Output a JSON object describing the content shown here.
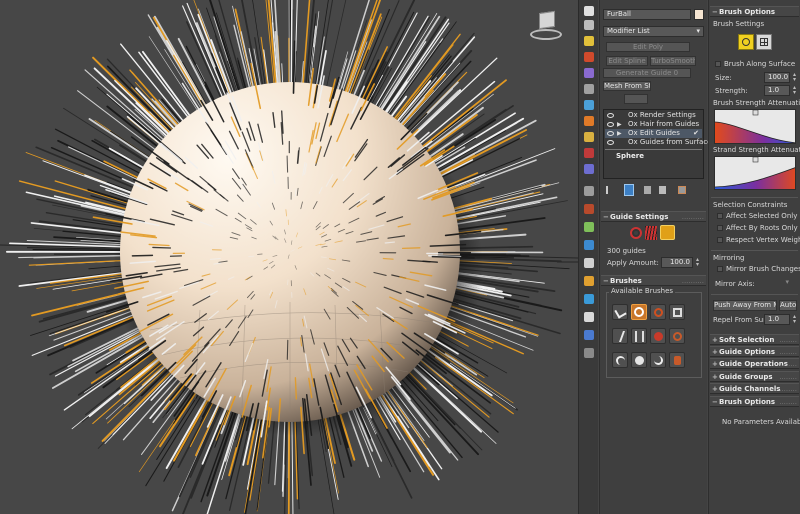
{
  "object_name": "FurBall",
  "modifier_list_label": "Modifier List",
  "modifier_buttons": [
    "Edit Poly",
    "Edit Spline",
    "TurboSmooth",
    "Generate Guide 0",
    "Mesh From Strand"
  ],
  "stack": [
    {
      "label": "Ox Render Settings",
      "expand": false,
      "checked": false
    },
    {
      "label": "Ox Hair from Guides",
      "expand": true,
      "checked": false
    },
    {
      "label": "Ox Edit Guides",
      "expand": true,
      "checked": true
    },
    {
      "label": "Ox Guides from Surface",
      "expand": false,
      "checked": false
    }
  ],
  "stack_base": "Sphere",
  "guide_settings": {
    "title": "Guide Settings",
    "count_text": "300 guides",
    "apply_amount_label": "Apply Amount:",
    "apply_amount_value": "100.0"
  },
  "brushes": {
    "title": "Brushes",
    "available_label": "Available Brushes"
  },
  "brush_options": {
    "title": "Brush Options",
    "brush_settings_label": "Brush Settings",
    "brush_along_surface_label": "Brush Along Surface",
    "size_label": "Size:",
    "size_value": "100.0",
    "strength_label": "Strength:",
    "strength_value": "1.0",
    "strength_attenuation_label": "Brush Strength Attenuation:",
    "strand_attenuation_label": "Strand Strength Attenuation:",
    "selection_constraints_label": "Selection Constraints",
    "affect_selected_label": "Affect Selected Only",
    "affect_roots_label": "Affect By Roots Only",
    "respect_weights_label": "Respect Vertex Weights",
    "mirroring_label": "Mirroring",
    "mirror_changes_label": "Mirror Brush Changes",
    "mirror_axis_label": "Mirror Axis:",
    "mirror_axis_value": "X",
    "push_away_label": "Push Away From Mesh",
    "auto_label": "Auto",
    "repel_label": "Repel From Surf.:",
    "repel_value": "1.0"
  },
  "collapsed_rollouts": [
    "Soft Selection",
    "Guide Options",
    "Guide Operations",
    "Guide Groups",
    "Guide Channels"
  ],
  "brush_options_bottom": {
    "title": "Brush Options",
    "no_params": "No Parameters Available"
  },
  "viewcube_label": "FRONT",
  "colors": {
    "guide_selected": "#e39a22",
    "guide_dark": "#1a1a1a",
    "guide_light": "#f0f0f0",
    "sphere": "#f6e6d2",
    "selected_brush": "#c8762a"
  }
}
